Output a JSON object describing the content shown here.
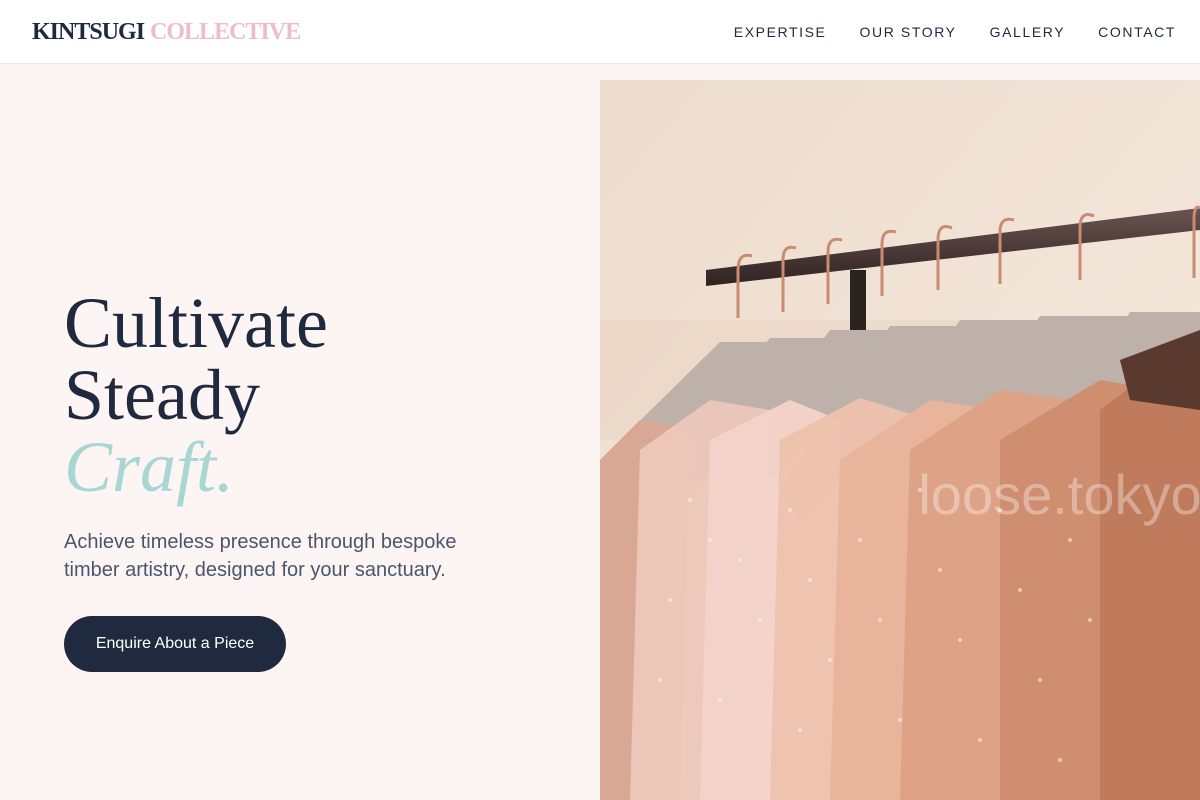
{
  "brand": {
    "primary": "KINTSUGI",
    "accent": "COLLECTIVE"
  },
  "nav": {
    "items": [
      {
        "label": "EXPERTISE"
      },
      {
        "label": "OUR STORY"
      },
      {
        "label": "GALLERY"
      },
      {
        "label": "CONTACT"
      }
    ]
  },
  "hero": {
    "title_line1": "Cultivate",
    "title_line2": "Steady",
    "title_line3": "Craft.",
    "subtitle": "Achieve timeless presence through bespoke timber artistry, designed for your sanctuary.",
    "cta_label": "Enquire About a Piece",
    "image_watermark": "loose.tokyo"
  },
  "colors": {
    "navy": "#1f2a3f",
    "pink_accent": "#f1bcca",
    "teal_accent": "#a8d6d3",
    "page_bg": "#fdf4f4"
  }
}
